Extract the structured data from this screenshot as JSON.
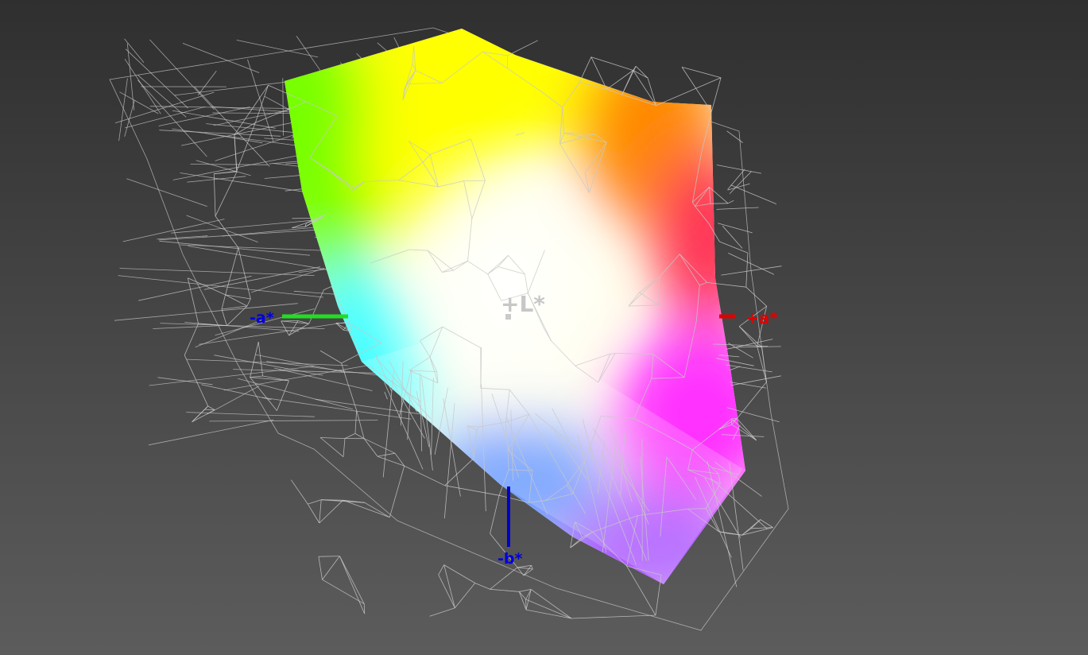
{
  "viewer": {
    "background_top": "#2f2f2f",
    "background_bottom": "#5c5c5c",
    "wireframe_color": "#c8c8c8"
  },
  "axes": {
    "l_plus": {
      "label": "+L*",
      "color": "#bdbdbd"
    },
    "a_plus": {
      "label": "+a*",
      "color": "#e00000"
    },
    "a_minus": {
      "label": "-a*",
      "color": "#0000e0"
    },
    "b_minus": {
      "label": "-b*",
      "color": "#0000e0"
    },
    "a_minus_line_color": "#22dd22",
    "a_plus_line_color": "#e00000",
    "b_minus_line_color": "#0000cc"
  },
  "gamut": {
    "colors": {
      "yellow": "#ffff00",
      "green": "#77ff00",
      "cyan": "#44ffff",
      "blue": "#6699ff",
      "violet": "#aa55ff",
      "magenta": "#ff33ff",
      "red": "#ff3355",
      "orange": "#ff8800",
      "white": "#ffffee"
    }
  }
}
